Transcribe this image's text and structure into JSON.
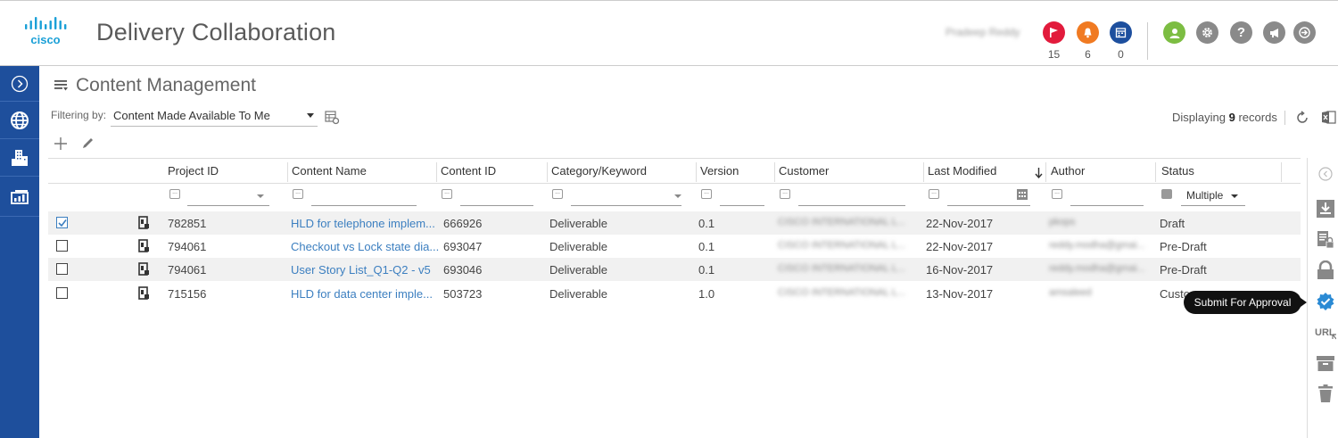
{
  "header": {
    "logo_text": "cisco",
    "title": "Delivery Collaboration",
    "user_name": "Pradeep Reddy",
    "notifications": [
      {
        "icon": "flag-icon",
        "color": "#e21b3c",
        "count": "15"
      },
      {
        "icon": "bell-icon",
        "color": "#f07a22",
        "count": "6"
      },
      {
        "icon": "calendar-icon",
        "color": "#1d4f9e",
        "count": "0"
      }
    ],
    "actions": [
      {
        "icon": "user-icon",
        "color": "#7cbd42"
      },
      {
        "icon": "gear-icon",
        "color": "#8a8a8a"
      },
      {
        "icon": "help-icon",
        "color": "#8a8a8a"
      },
      {
        "icon": "megaphone-icon",
        "color": "#8a8a8a"
      },
      {
        "icon": "logout-icon",
        "color": "#8a8a8a"
      }
    ]
  },
  "sidebar": {
    "color": "#1e4f9c",
    "items": [
      "expand-icon",
      "globe-icon",
      "building-icon",
      "dashboard-icon"
    ]
  },
  "main": {
    "title": "Content Management",
    "filter_label": "Filtering by:",
    "filter_value": "Content Made Available To Me",
    "records_prefix": "Displaying",
    "records_count": "9",
    "records_suffix": "records"
  },
  "table": {
    "columns": [
      "Project ID",
      "Content Name",
      "Content ID",
      "Category/Keyword",
      "Version",
      "Customer",
      "Last Modified",
      "Author",
      "Status"
    ],
    "status_filter": "Multiple",
    "rows": [
      {
        "checked": true,
        "project_id": "782851",
        "content_name": "HLD for telephone implem...",
        "content_id": "666926",
        "category": "Deliverable",
        "version": "0.1",
        "customer": "CISCO INTERNATIONAL L...",
        "last_modified": "22-Nov-2017",
        "author": "pkops",
        "status": "Draft"
      },
      {
        "checked": false,
        "project_id": "794061",
        "content_name": "Checkout vs Lock state dia...",
        "content_id": "693047",
        "category": "Deliverable",
        "version": "0.1",
        "customer": "CISCO INTERNATIONAL L...",
        "last_modified": "22-Nov-2017",
        "author": "reddy.modha@gmai...",
        "status": "Pre-Draft"
      },
      {
        "checked": false,
        "project_id": "794061",
        "content_name": "User Story List_Q1-Q2 - v5",
        "content_id": "693046",
        "category": "Deliverable",
        "version": "0.1",
        "customer": "CISCO INTERNATIONAL L...",
        "last_modified": "16-Nov-2017",
        "author": "reddy.modha@gmai...",
        "status": "Pre-Draft"
      },
      {
        "checked": false,
        "project_id": "715156",
        "content_name": "HLD for data center imple...",
        "content_id": "503723",
        "category": "Deliverable",
        "version": "1.0",
        "customer": "CISCO INTERNATIONAL L...",
        "last_modified": "13-Nov-2017",
        "author": "amsaleed",
        "status": "Custo..."
      }
    ]
  },
  "right_panel": {
    "tooltip": "Submit For Approval",
    "icons": [
      "collapse-icon",
      "download-icon",
      "lock-document-icon",
      "lock-icon",
      "approve-badge-icon",
      "url-icon",
      "archive-icon",
      "trash-icon"
    ]
  }
}
